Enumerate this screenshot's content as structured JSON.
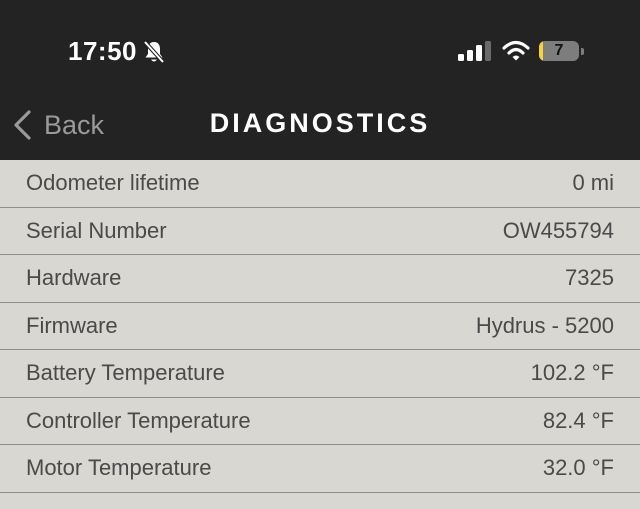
{
  "status_bar": {
    "time": "17:50",
    "battery_level": "7",
    "icons": [
      "bell-slash-icon",
      "cellular-signal-icon",
      "wifi-icon",
      "battery-icon"
    ]
  },
  "nav": {
    "back_label": "Back",
    "title": "DIAGNOSTICS"
  },
  "rows": [
    {
      "label": "Odometer lifetime",
      "value": "0 mi"
    },
    {
      "label": "Serial Number",
      "value": "OW455794"
    },
    {
      "label": "Hardware",
      "value": "7325"
    },
    {
      "label": "Firmware",
      "value": "Hydrus - 5200"
    },
    {
      "label": "Battery Temperature",
      "value": "102.2 °F"
    },
    {
      "label": "Controller Temperature",
      "value": "82.4 °F"
    },
    {
      "label": "Motor Temperature",
      "value": "32.0 °F"
    }
  ],
  "colors": {
    "header_bg": "#232323",
    "list_bg": "#d8d7d2",
    "text": "#4a4a4a",
    "battery_low": "#f4d23b"
  }
}
